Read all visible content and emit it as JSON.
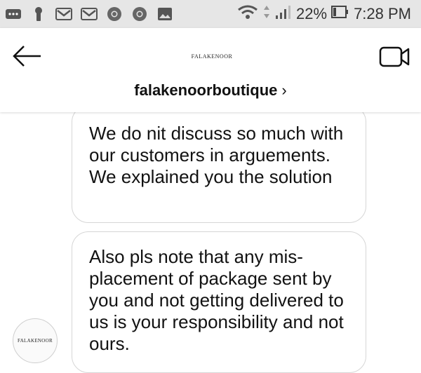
{
  "status_bar": {
    "battery": "22%",
    "time": "7:28 PM"
  },
  "header": {
    "logo_text": "FALAKENOOR",
    "username": "falakenoorboutique",
    "chevron": "›"
  },
  "messages": [
    {
      "text": "We do nit discuss so much with our customers in arguements. We explained you the solution"
    },
    {
      "text": "Also pls note that any mis-placement of package sent by you and not getting delivered to us is your responsibility and not ours."
    }
  ],
  "avatar": {
    "text": "FALAKENOOR"
  }
}
